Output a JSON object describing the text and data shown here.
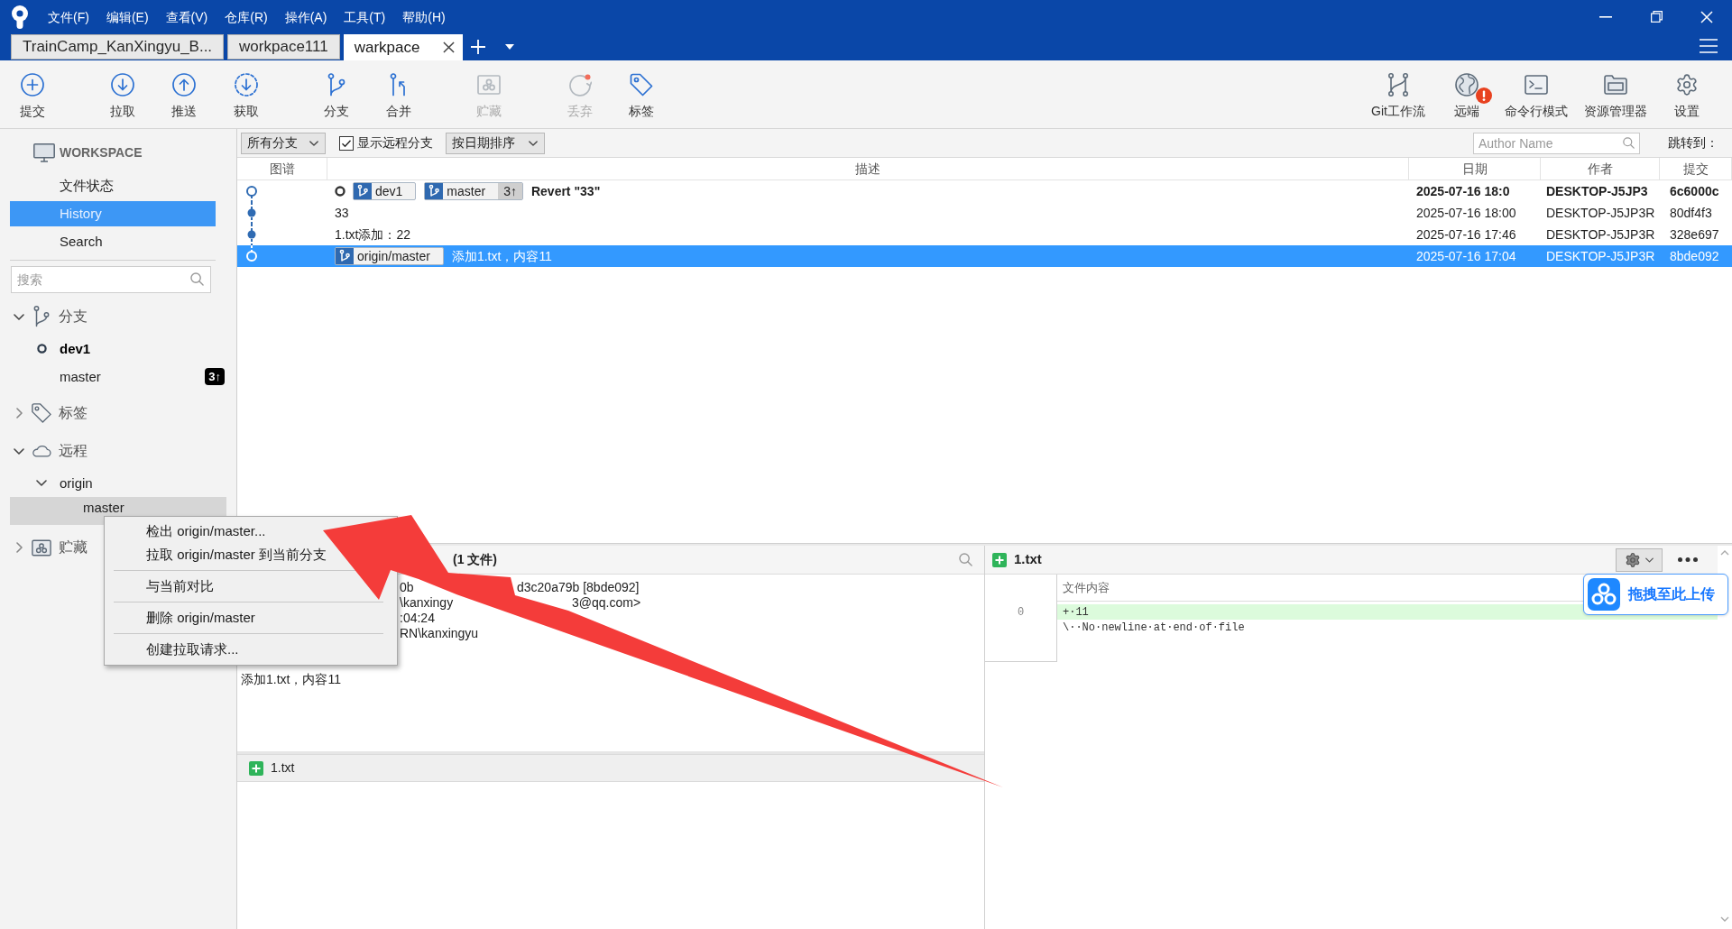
{
  "title_bar": {
    "menu": [
      "文件(F)",
      "编辑(E)",
      "查看(V)",
      "仓库(R)",
      "操作(A)",
      "工具(T)",
      "帮助(H)"
    ]
  },
  "tabs": [
    {
      "label": "TrainCamp_KanXingyu_B...",
      "selected": false
    },
    {
      "label": "workpace111",
      "selected": false
    },
    {
      "label": "warkpace",
      "selected": true
    }
  ],
  "toolbar": {
    "left": [
      {
        "label": "提交",
        "disabled": false
      },
      {
        "label": "拉取",
        "disabled": false
      },
      {
        "label": "推送",
        "disabled": false
      },
      {
        "label": "获取",
        "disabled": false
      },
      {
        "label": "分支",
        "disabled": false
      },
      {
        "label": "合并",
        "disabled": false
      },
      {
        "label": "贮藏",
        "disabled": true
      },
      {
        "label": "丢弃",
        "disabled": true
      },
      {
        "label": "标签",
        "disabled": false
      }
    ],
    "right": [
      {
        "label": "Git工作流",
        "alert": false
      },
      {
        "label": "远端",
        "alert": true
      },
      {
        "label": "命令行模式",
        "alert": false
      },
      {
        "label": "资源管理器",
        "alert": false
      },
      {
        "label": "设置",
        "alert": false
      }
    ]
  },
  "sidebar": {
    "workspace": {
      "title": "WORKSPACE",
      "items": [
        {
          "label": "文件状态",
          "selected": false
        },
        {
          "label": "History",
          "selected": true
        },
        {
          "label": "Search",
          "selected": false
        }
      ]
    },
    "search": {
      "placeholder": "搜索"
    },
    "sections": [
      {
        "label": "分支",
        "expanded": true,
        "children": [
          {
            "label": "dev1",
            "current": true,
            "selected": false
          },
          {
            "label": "master",
            "current": false,
            "selected": false,
            "badge": "3↑"
          }
        ]
      },
      {
        "label": "标签",
        "expanded": false
      },
      {
        "label": "远程",
        "expanded": true,
        "children": [
          {
            "label": "origin",
            "expanded": true,
            "children": [
              {
                "label": "master",
                "selected": true
              }
            ]
          }
        ]
      },
      {
        "label": "贮藏",
        "expanded": false
      }
    ]
  },
  "filter_bar": {
    "branch_filter": "所有分支",
    "show_remote": {
      "label": "显示远程分支",
      "checked": true
    },
    "sort": "按日期排序",
    "author_search": {
      "placeholder": "Author Name"
    },
    "jump_label": "跳转到："
  },
  "commits": {
    "columns": [
      "图谱",
      "描述",
      "日期",
      "作者",
      "提交"
    ],
    "rows": [
      {
        "hollow": true,
        "head": true,
        "selected": false,
        "refs": [
          {
            "label": "dev1"
          },
          {
            "label": "master",
            "ahead": "3↑"
          }
        ],
        "message": "Revert \"33\"",
        "date": "2025-07-16 18:0",
        "author": "DESKTOP-J5JP3",
        "commit": "6c6000c"
      },
      {
        "hollow": false,
        "head": false,
        "selected": false,
        "message": "33",
        "date": "2025-07-16 18:00",
        "author": "DESKTOP-J5JP3R",
        "commit": "80df4f3"
      },
      {
        "hollow": false,
        "head": false,
        "selected": false,
        "message": "1.txt添加：22",
        "date": "2025-07-16 17:46",
        "author": "DESKTOP-J5JP3R",
        "commit": "328e697"
      },
      {
        "hollow": true,
        "head": false,
        "selected": true,
        "refs": [
          {
            "label": "origin/master"
          }
        ],
        "message": "添加1.txt，内容11",
        "date": "2025-07-16 17:04",
        "author": "DESKTOP-J5JP3R",
        "commit": "8bde092"
      }
    ]
  },
  "details": {
    "header": "(1 文件)",
    "lines": [
      [
        "0b",
        "d3c20a79b [8bde092]"
      ],
      [
        "\\kanxingy",
        "3@qq.com>"
      ],
      [
        ":04:24"
      ],
      [
        "RN\\kanxingyu"
      ]
    ],
    "message": "添加1.txt，内容11",
    "files": [
      {
        "name": "1.txt",
        "added": true
      }
    ]
  },
  "diff": {
    "file": {
      "name": "1.txt",
      "added": true
    },
    "column": "文件内容",
    "lines": [
      {
        "number": "0",
        "text": "+·11",
        "kind": "added"
      },
      {
        "text": "\\··No·newline·at·end·of·file",
        "kind": "note"
      }
    ]
  },
  "context_menu": {
    "groups": [
      [
        "检出 origin/master...",
        "拉取 origin/master 到当前分支"
      ],
      [
        "与当前对比"
      ],
      [
        "删除 origin/master"
      ],
      [
        "创建拉取请求..."
      ]
    ]
  },
  "upload_widget": {
    "label": "拖拽至此上传"
  }
}
